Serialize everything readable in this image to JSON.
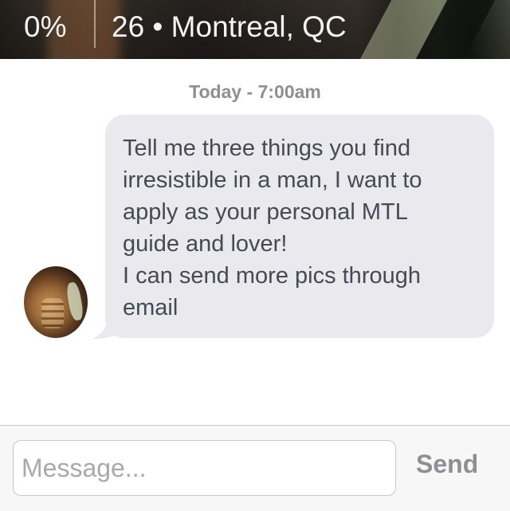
{
  "header": {
    "match_percent": "0%",
    "age_location": "26 • Montreal, QC"
  },
  "chat": {
    "timestamp": "Today - 7:00am",
    "message_lines": [
      "Tell me three things you find",
      "irresistible in a man, I want to",
      "apply as your personal MTL",
      "guide and lover!",
      "I can send more pics through",
      "email"
    ]
  },
  "composer": {
    "placeholder": "Message...",
    "send_label": "Send"
  },
  "colors": {
    "bubble": "#e9e9ee",
    "bubble_text": "#454a55",
    "timestamp": "#8e8e93",
    "send": "#8e8e93"
  }
}
